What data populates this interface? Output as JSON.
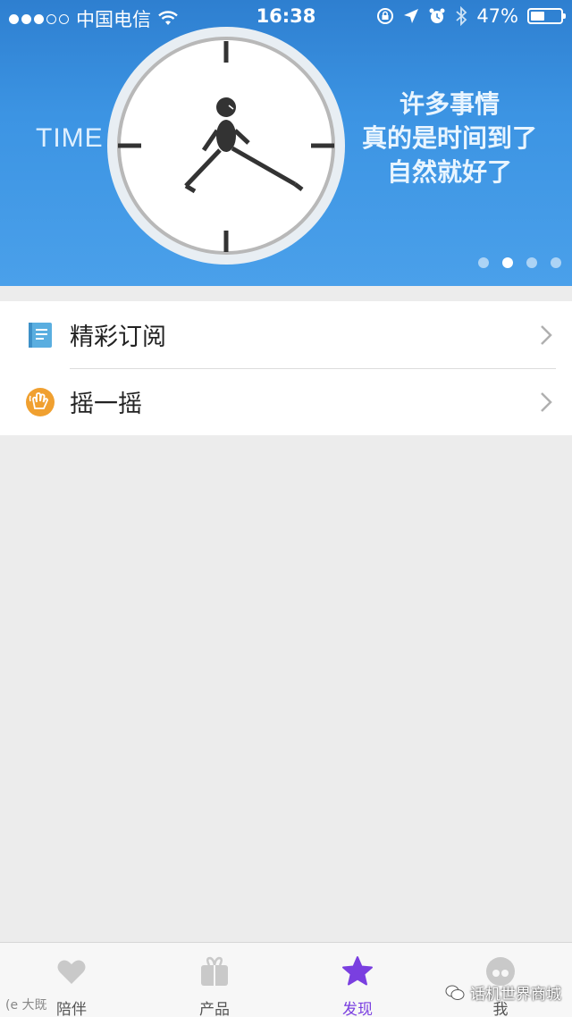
{
  "status_bar": {
    "carrier": "中国电信",
    "time": "16:38",
    "battery_percent": "47%",
    "battery_level": 0.47,
    "signal_bars_on": 3,
    "signal_bars_total": 5
  },
  "banner": {
    "time_word": "TIME",
    "slogan_lines": [
      "许多事情",
      "真的是时间到了",
      "自然就好了"
    ],
    "carousel_pages": 4,
    "carousel_active_index": 1
  },
  "menu": {
    "items": [
      {
        "label": "精彩订阅",
        "icon": "subscription-book-icon"
      },
      {
        "label": "摇一摇",
        "icon": "shake-hand-icon"
      }
    ]
  },
  "tabbar": {
    "tabs": [
      {
        "label": "陪伴",
        "icon": "heart-icon",
        "active": false
      },
      {
        "label": "产品",
        "icon": "gift-box-icon",
        "active": false
      },
      {
        "label": "发现",
        "icon": "star-icon",
        "active": true
      },
      {
        "label": "我",
        "icon": "avatar-icon",
        "active": false
      }
    ]
  },
  "watermark": {
    "left_text": "(e 大既",
    "right_text": "话机世界商城"
  },
  "colors": {
    "banner_blue": "#3c94e3",
    "active_tab": "#7a3fe0",
    "shake_orange": "#f0a030",
    "book_blue": "#5aaee0"
  }
}
